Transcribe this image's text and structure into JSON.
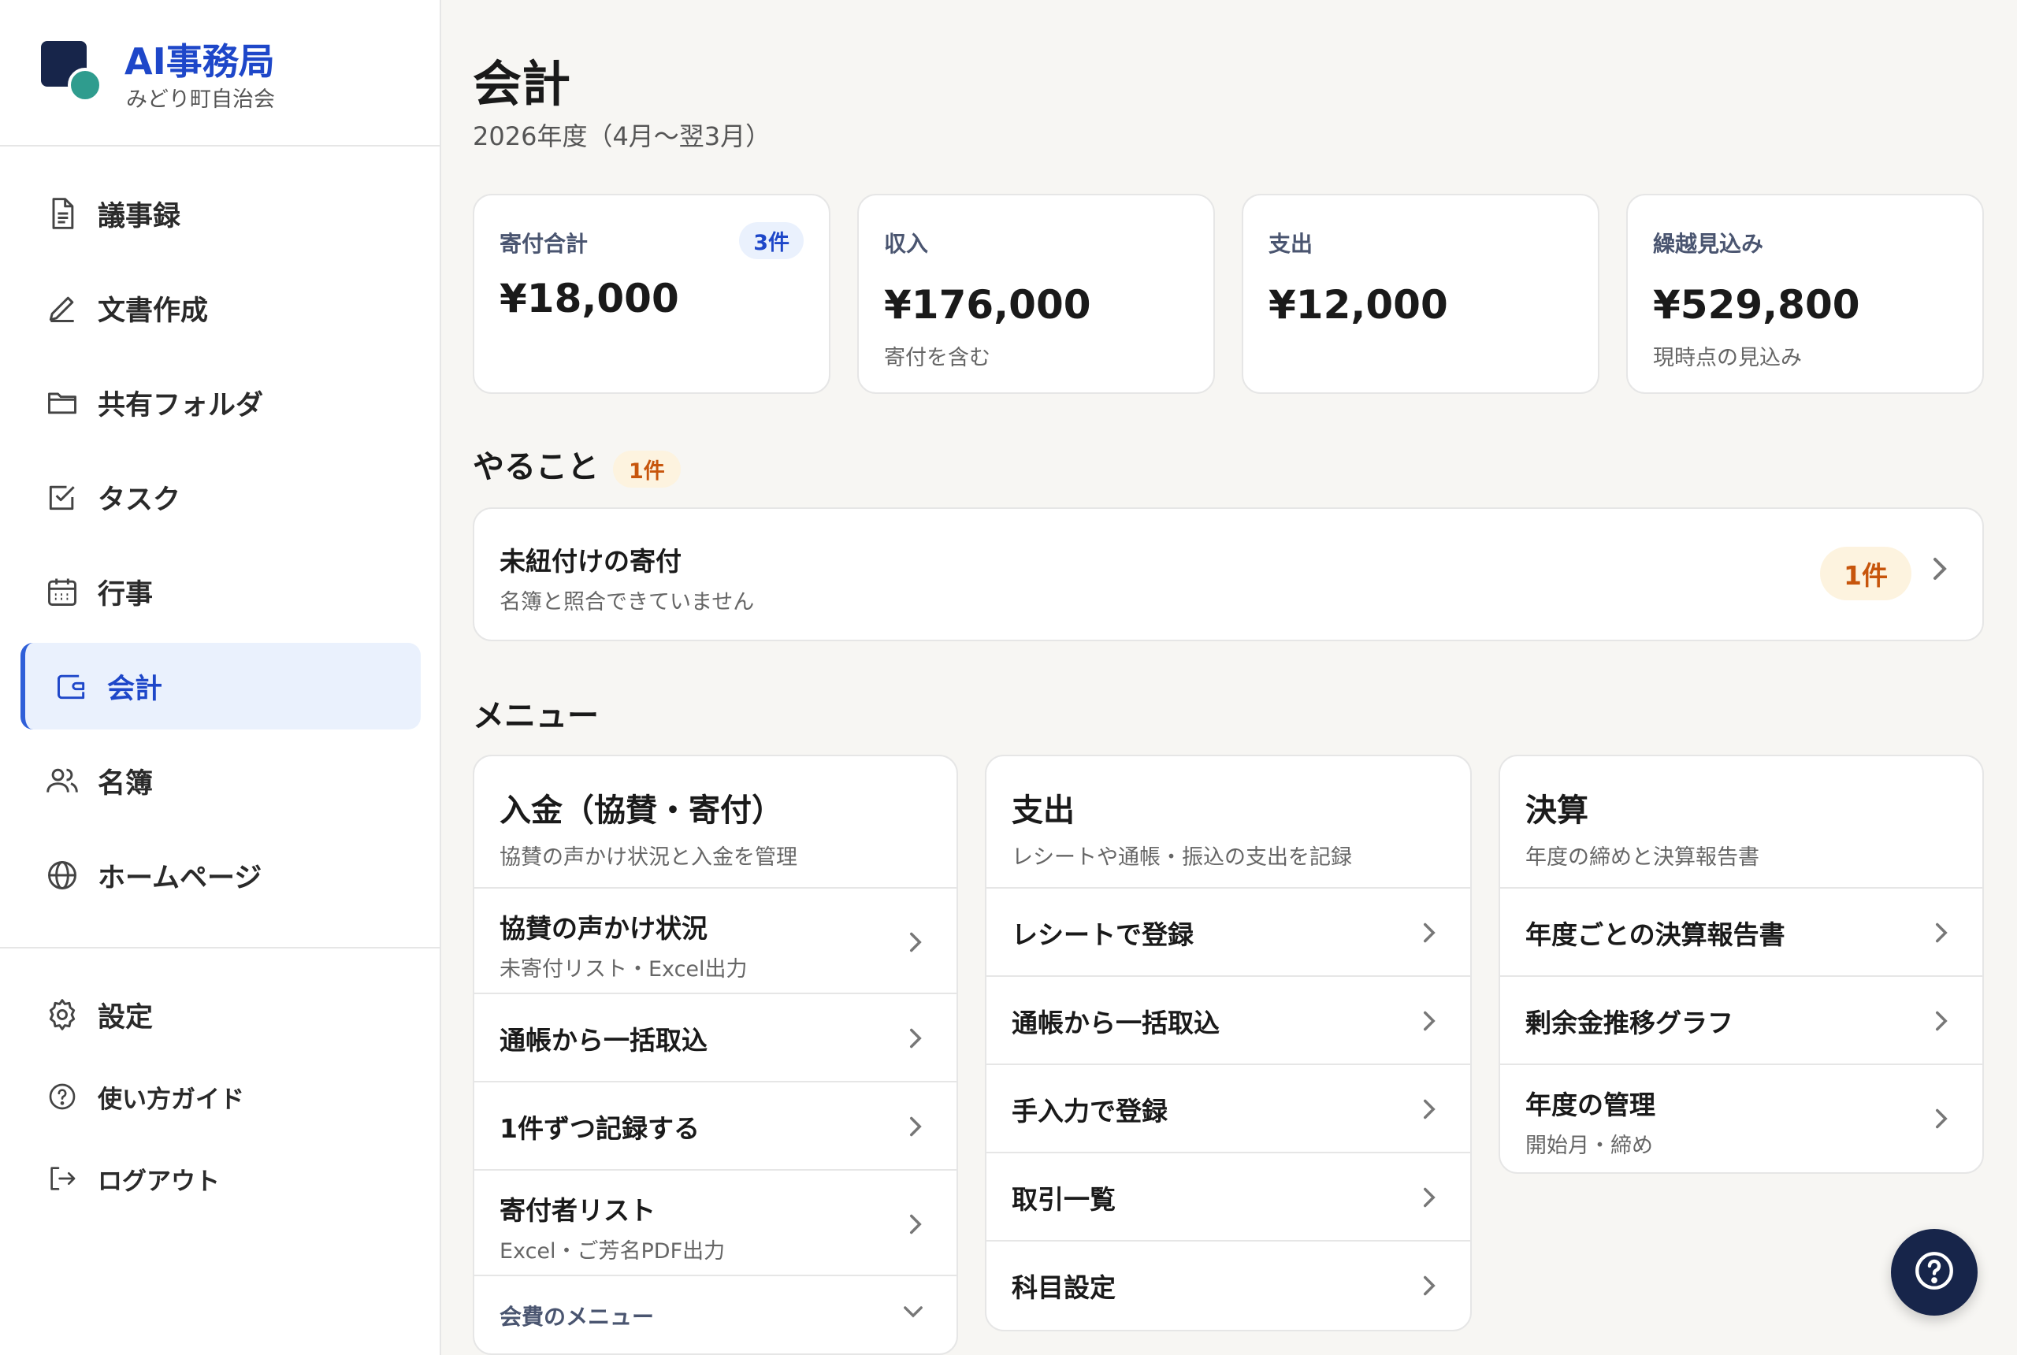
{
  "brand": {
    "title": "AI事務局",
    "subtitle": "みどり町自治会"
  },
  "nav": [
    {
      "label": "議事録",
      "icon": "document-icon"
    },
    {
      "label": "文書作成",
      "icon": "pencil-icon"
    },
    {
      "label": "共有フォルダ",
      "icon": "folder-icon"
    },
    {
      "label": "タスク",
      "icon": "checkbox-icon"
    },
    {
      "label": "行事",
      "icon": "calendar-icon"
    },
    {
      "label": "会計",
      "icon": "wallet-icon",
      "active": true
    },
    {
      "label": "名簿",
      "icon": "users-icon"
    },
    {
      "label": "ホームページ",
      "icon": "globe-icon"
    }
  ],
  "nav_bottom": [
    {
      "label": "設定",
      "icon": "gear-icon"
    },
    {
      "label": "使い方ガイド",
      "icon": "help-circle-icon"
    },
    {
      "label": "ログアウト",
      "icon": "logout-icon"
    }
  ],
  "page": {
    "title": "会計",
    "subtitle": "2026年度（4月〜翌3月）"
  },
  "stats": [
    {
      "label": "寄付合計",
      "value": "¥18,000",
      "badge": "3件",
      "note": ""
    },
    {
      "label": "収入",
      "value": "¥176,000",
      "note": "寄付を含む"
    },
    {
      "label": "支出",
      "value": "¥12,000",
      "note": ""
    },
    {
      "label": "繰越見込み",
      "value": "¥529,800",
      "note": "現時点の見込み"
    }
  ],
  "todo": {
    "heading": "やること",
    "badge": "1件",
    "item": {
      "title": "未紐付けの寄付",
      "subtitle": "名簿と照合できていません",
      "count": "1件"
    }
  },
  "menu": {
    "heading": "メニュー",
    "columns": [
      {
        "title": "入金（協賛・寄付）",
        "desc": "協賛の声かけ状況と入金を管理",
        "rows": [
          {
            "title": "協賛の声かけ状況",
            "sub": "未寄付リスト・Excel出力"
          },
          {
            "title": "通帳から一括取込"
          },
          {
            "title": "1件ずつ記録する"
          },
          {
            "title": "寄付者リスト",
            "sub": "Excel・ご芳名PDF出力"
          }
        ],
        "footer": "会費のメニュー"
      },
      {
        "title": "支出",
        "desc": "レシートや通帳・振込の支出を記録",
        "rows": [
          {
            "title": "レシートで登録"
          },
          {
            "title": "通帳から一括取込"
          },
          {
            "title": "手入力で登録"
          },
          {
            "title": "取引一覧"
          },
          {
            "title": "科目設定"
          }
        ]
      },
      {
        "title": "決算",
        "desc": "年度の締めと決算報告書",
        "rows": [
          {
            "title": "年度ごとの決算報告書"
          },
          {
            "title": "剰余金推移グラフ"
          },
          {
            "title": "年度の管理",
            "sub": "開始月・締め"
          }
        ]
      }
    ]
  },
  "colors": {
    "accent": "#1e47c9",
    "navy": "#17254a",
    "teal": "#2f9c8e",
    "orange": "#c7550c",
    "bg": "#f7f6f3"
  }
}
